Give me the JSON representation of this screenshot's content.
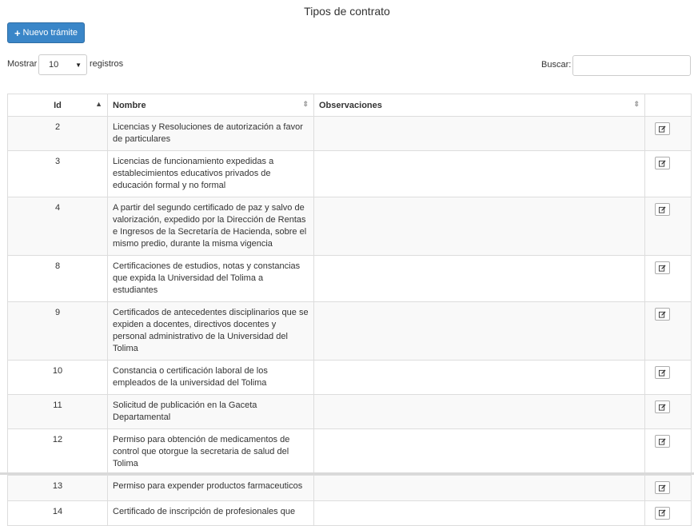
{
  "page": {
    "title": "Tipos de contrato"
  },
  "toolbar": {
    "new_label": "Nuevo trámite",
    "new_icon": "plus-icon"
  },
  "length": {
    "prefix": "Mostrar",
    "value": "10",
    "suffix": "registros"
  },
  "search": {
    "label": "Buscar:",
    "value": "",
    "placeholder": ""
  },
  "table": {
    "columns": [
      "Id",
      "Nombre",
      "Observaciones",
      ""
    ],
    "rows": [
      {
        "id": "2",
        "nombre": "Licencias y Resoluciones de autorización a favor de particulares",
        "observaciones": ""
      },
      {
        "id": "3",
        "nombre": "Licencias de funcionamiento expedidas a establecimientos educativos privados de educación formal y no formal",
        "observaciones": ""
      },
      {
        "id": "4",
        "nombre": "A partir del segundo certificado de paz y salvo de valorización, expedido por la Dirección de Rentas e Ingresos de la Secretaría de Hacienda, sobre el mismo predio, durante la misma vigencia",
        "observaciones": ""
      },
      {
        "id": "8",
        "nombre": "Certificaciones de estudios, notas y constancias que expida la Universidad del Tolima a estudiantes",
        "observaciones": ""
      },
      {
        "id": "9",
        "nombre": "Certificados de antecedentes disciplinarios que se expiden a docentes, directivos docentes y personal administrativo de la Universidad del Tolima",
        "observaciones": ""
      },
      {
        "id": "10",
        "nombre": "Constancia o certificación laboral de los empleados de la universidad del Tolima",
        "observaciones": ""
      },
      {
        "id": "11",
        "nombre": "Solicitud de publicación en la Gaceta Departamental",
        "observaciones": ""
      },
      {
        "id": "12",
        "nombre": "Permiso para obtención de medicamentos de control que otorgue la secretaria de salud del Tolima",
        "observaciones": ""
      },
      {
        "id": "13",
        "nombre": "Permiso para expender productos farmaceuticos",
        "observaciones": ""
      },
      {
        "id": "14",
        "nombre": "Certificado de inscripción de profesionales que",
        "observaciones": ""
      }
    ]
  }
}
